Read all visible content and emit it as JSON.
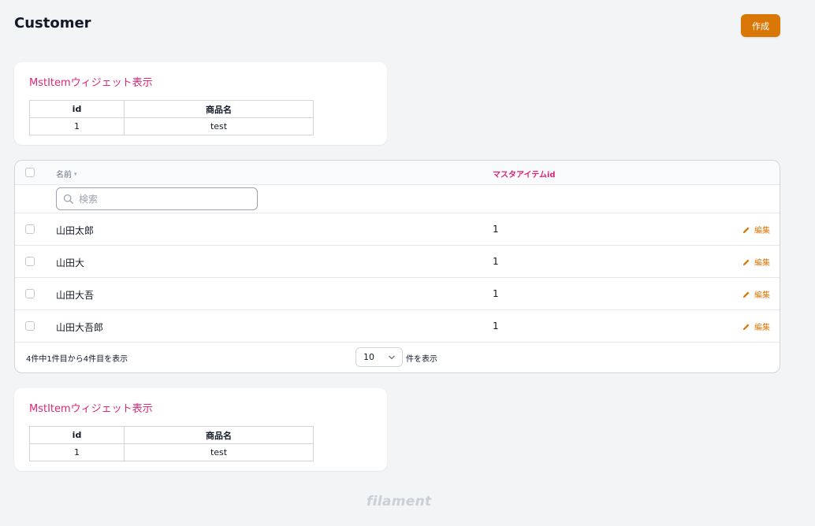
{
  "header": {
    "title": "Customer",
    "create_label": "作成"
  },
  "widget": {
    "title": "MstItemウィジェット表示",
    "columns": [
      "id",
      "商品名"
    ],
    "rows": [
      [
        "1",
        "test"
      ]
    ]
  },
  "table": {
    "columns": {
      "name": "名前",
      "master_item_id": "マスタアイテムid"
    },
    "search": {
      "placeholder": "検索",
      "value": ""
    },
    "rows": [
      {
        "name": "山田太郎",
        "master_item_id": "1",
        "edit_label": "編集"
      },
      {
        "name": "山田大",
        "master_item_id": "1",
        "edit_label": "編集"
      },
      {
        "name": "山田大吾",
        "master_item_id": "1",
        "edit_label": "編集"
      },
      {
        "name": "山田大吾郎",
        "master_item_id": "1",
        "edit_label": "編集"
      }
    ],
    "footer": {
      "summary": "4件中1件目から4件目を表示",
      "per_page_value": "10",
      "per_page_suffix": "件を表示"
    }
  },
  "brand": "filament",
  "colors": {
    "primary": "#d97706",
    "accent_pink": "#db2777",
    "background": "#f3f4f6"
  }
}
